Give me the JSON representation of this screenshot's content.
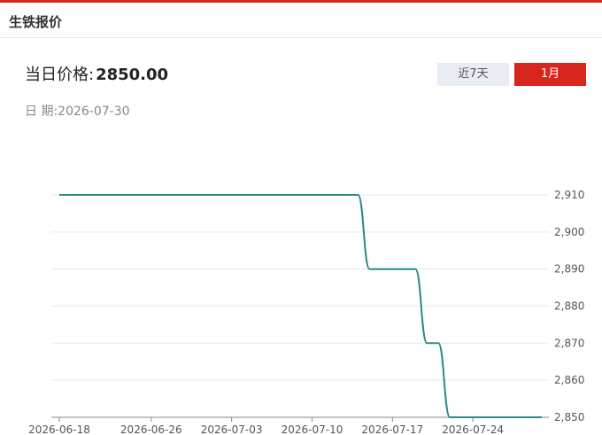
{
  "header": {
    "title": "生铁报价"
  },
  "price": {
    "label": "当日价格:",
    "value": "2850.00"
  },
  "date": {
    "label": "日    期:",
    "value": "2026-07-30"
  },
  "range_buttons": [
    {
      "label": "近7天",
      "active": false
    },
    {
      "label": "1月",
      "active": true
    }
  ],
  "colors": {
    "accent": "#d7261e",
    "line": "#2b8a8a",
    "grid": "#e6e9f0"
  },
  "chart_data": {
    "type": "line",
    "x_tick_labels": [
      "2026-06-18",
      "2026-06-26",
      "2026-07-03",
      "2026-07-10",
      "2026-07-17",
      "2026-07-24"
    ],
    "y_tick_labels": [
      "2,910",
      "2,900",
      "2,890",
      "2,880",
      "2,870",
      "2,860",
      "2,850"
    ],
    "ylim": [
      2850,
      2910
    ],
    "y_axis_position": "right",
    "grid": true,
    "series": [
      {
        "x": [
          "2026-06-18",
          "2026-07-14",
          "2026-07-15",
          "2026-07-19",
          "2026-07-20",
          "2026-07-21",
          "2026-07-22",
          "2026-07-30"
        ],
        "values": [
          2910,
          2910,
          2890,
          2890,
          2870,
          2870,
          2850,
          2850
        ]
      }
    ]
  }
}
